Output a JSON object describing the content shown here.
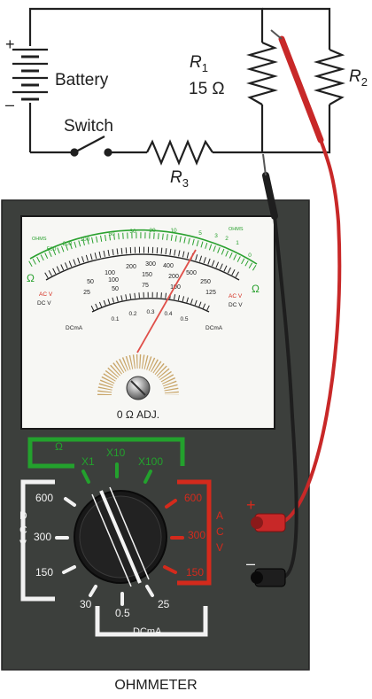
{
  "circuit": {
    "battery_label": "Battery",
    "battery_plus": "+",
    "battery_minus": "–",
    "switch_label": "Switch",
    "r1_letter": "R",
    "r1_sub": "1",
    "r1_value": "15 Ω",
    "r2_letter": "R",
    "r2_sub": "2",
    "r3_letter": "R",
    "r3_sub": "3"
  },
  "meter": {
    "adj_label": "0 Ω ADJ.",
    "ohm_symbol": "Ω",
    "ohms_left": "OHMS",
    "ohms_right": "OHMS",
    "acv_left": "AC V",
    "dcv_left": "DC V",
    "acv_right": "AC V",
    "dcv_right": "DC V",
    "dcma_left": "DCmA",
    "dcma_right": "DCmA",
    "ohm_scale": [
      "500",
      "200",
      "100",
      "50",
      "30",
      "20",
      "10",
      "5",
      "3",
      "2",
      "1",
      "0"
    ],
    "volt_rows": [
      [
        "100",
        "200",
        "300",
        "400",
        "500"
      ],
      [
        "50",
        "100",
        "150",
        "200",
        "250"
      ],
      [
        "25",
        "50",
        "75",
        "100",
        "125"
      ]
    ],
    "ma_scale": [
      "0.1",
      "0.2",
      "0.3",
      "0.4",
      "0.5"
    ],
    "ohm_ranges": {
      "group": "Ω",
      "x1": "X1",
      "x10": "X10",
      "x100": "X100"
    },
    "dcv_letters": [
      "D",
      "C",
      "V"
    ],
    "dcv_ranges": [
      "600",
      "300",
      "150"
    ],
    "acv_letters": [
      "A",
      "C",
      "V"
    ],
    "acv_ranges": [
      "600",
      "300",
      "150"
    ],
    "dcma_ranges": [
      "30",
      "0.5",
      "25"
    ],
    "dcma_label": "DCmA",
    "plus_jack": "+",
    "minus_jack": "–",
    "caption": "OHMMETER"
  },
  "colors": {
    "red_lead": "#c82828",
    "black_lead": "#1e1e1e",
    "green_frame": "#23a12d",
    "red_frame": "#d42a1c",
    "meter_body": "#3c3f3c"
  }
}
